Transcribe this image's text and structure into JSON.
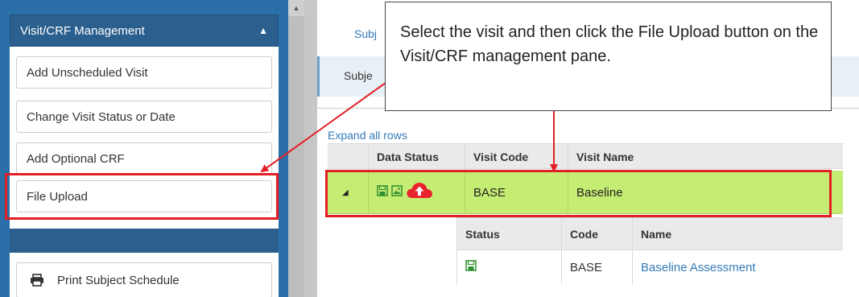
{
  "left_pane": {
    "header": "Visit/CRF Management",
    "buttons": [
      "Add Unscheduled Visit",
      "Change Visit Status or Date",
      "Add Optional CRF",
      "File Upload"
    ],
    "print_button": "Print Subject Schedule"
  },
  "right_pane": {
    "tab_partial": "Subj",
    "subheader_partial": "Subje",
    "expand_link": "Expand all rows",
    "table": {
      "headers": [
        "Data Status",
        "Visit Code",
        "Visit Name"
      ],
      "row": {
        "visit_code": "BASE",
        "visit_name": "Baseline"
      }
    },
    "subtable": {
      "headers": [
        "Status",
        "Code",
        "Name"
      ],
      "row": {
        "code": "BASE",
        "name": "Baseline Assessment"
      }
    }
  },
  "callout": {
    "text": "Select the visit and then click the File Upload button on the Visit/CRF management pane."
  },
  "colors": {
    "pane_blue": "#2a6fa8",
    "highlight_red": "#e31f26",
    "row_green": "#c5ec73",
    "link_blue": "#337ab7",
    "upload_icon_red": "#e8232b",
    "status_icon_green": "#2f8f2f"
  },
  "icons": {
    "collapse": "chevron-up-icon",
    "print": "printer-icon",
    "status": [
      "saved-icon",
      "image-icon",
      "cloud-upload-icon"
    ],
    "sub_status": "saved-icon"
  }
}
